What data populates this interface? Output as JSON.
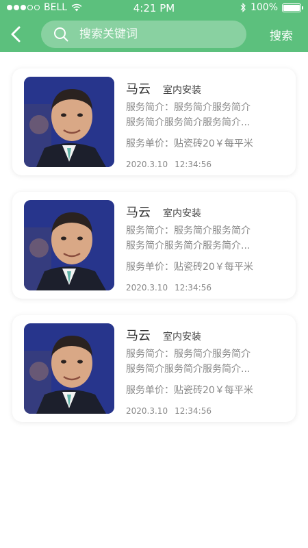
{
  "status_bar": {
    "carrier": "BELL",
    "time": "4:21 PM",
    "battery": "100%"
  },
  "nav": {
    "search_placeholder": "搜索关键词",
    "search_button": "搜索"
  },
  "colors": {
    "header": "#5cc07d",
    "card_bg": "#ffffff"
  },
  "services": [
    {
      "name": "马云",
      "tag": "室内安装",
      "desc_line1": "服务简介：服务简介服务简介",
      "desc_line2": "服务简介服务简介服务简介...",
      "price": "服务单价：贴瓷砖20￥每平米",
      "date": "2020.3.10",
      "time": "12:34:56"
    },
    {
      "name": "马云",
      "tag": "室内安装",
      "desc_line1": "服务简介：服务简介服务简介",
      "desc_line2": "服务简介服务简介服务简介...",
      "price": "服务单价：贴瓷砖20￥每平米",
      "date": "2020.3.10",
      "time": "12:34:56"
    },
    {
      "name": "马云",
      "tag": "室内安装",
      "desc_line1": "服务简介：服务简介服务简介",
      "desc_line2": "服务简介服务简介服务简介...",
      "price": "服务单价：贴瓷砖20￥每平米",
      "date": "2020.3.10",
      "time": "12:34:56"
    }
  ]
}
